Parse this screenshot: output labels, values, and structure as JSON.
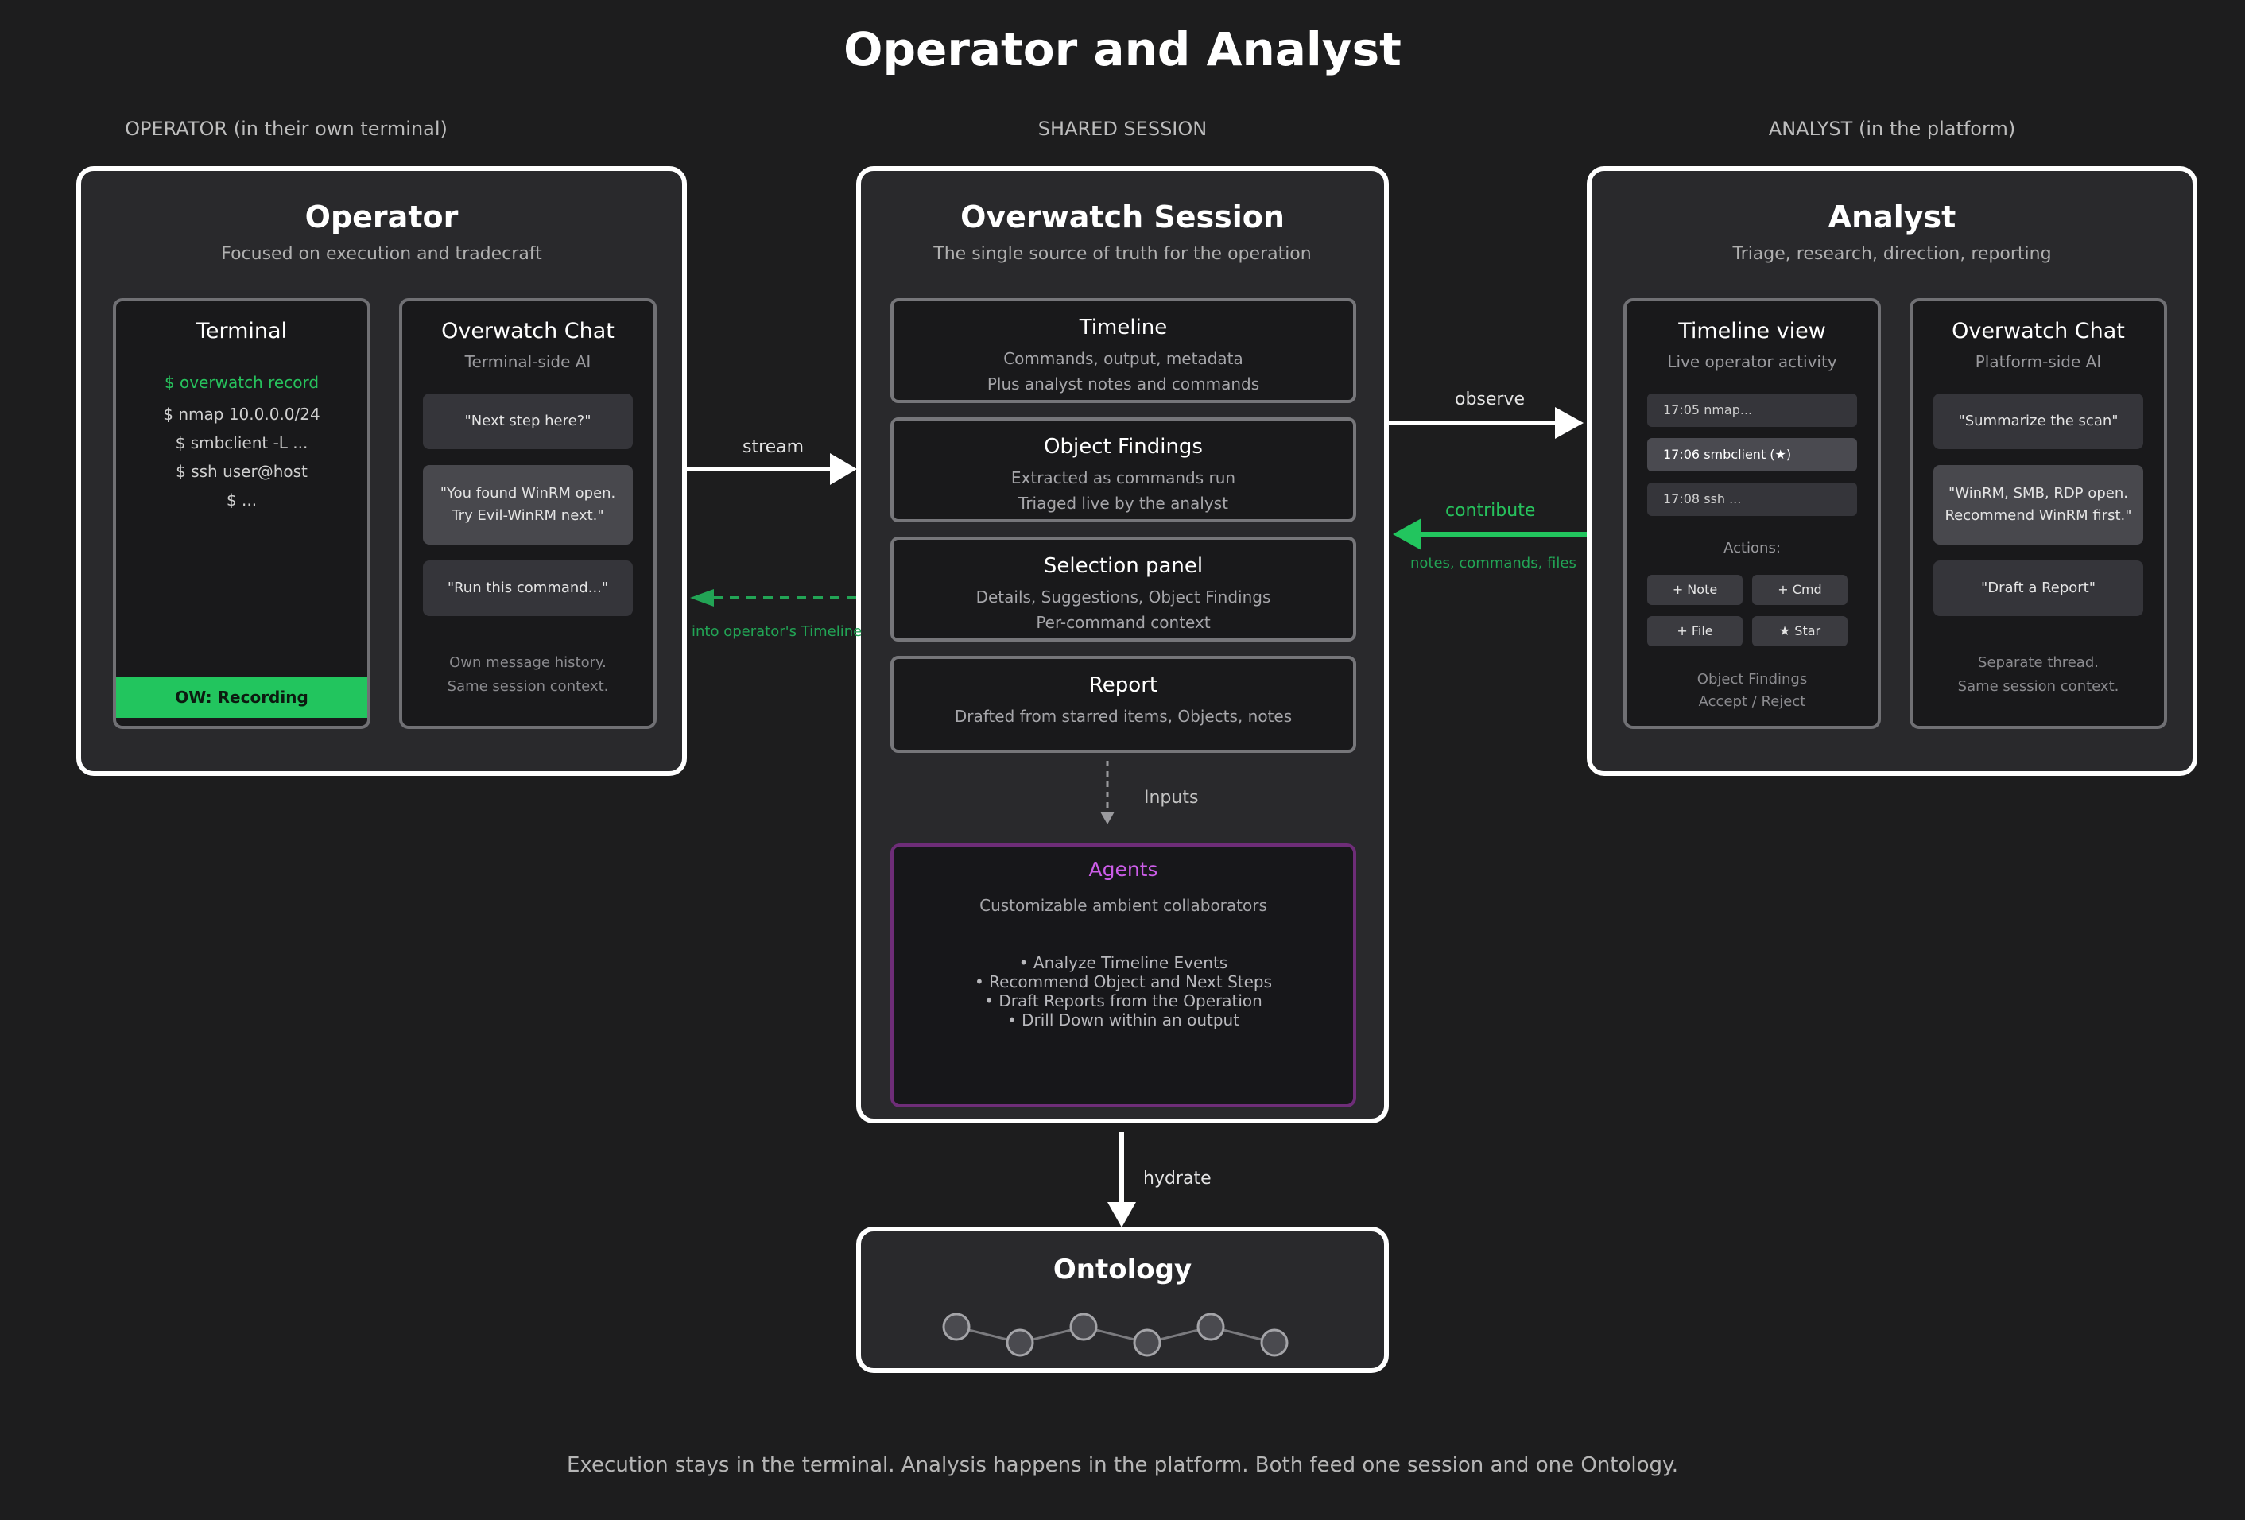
{
  "title": "Operator and Analyst",
  "columns": {
    "operator": "OPERATOR (in their own terminal)",
    "shared": "SHARED SESSION",
    "analyst": "ANALYST (in the platform)"
  },
  "operator": {
    "title": "Operator",
    "subtitle": "Focused on execution and tradecraft",
    "terminal": {
      "title": "Terminal",
      "lines": [
        "$ overwatch record",
        "$ nmap 10.0.0.0/24",
        "$ smbclient -L ...",
        "$ ssh user@host",
        "$ ..."
      ],
      "status": "OW: Recording"
    },
    "chat": {
      "title": "Overwatch Chat",
      "subtitle": "Terminal-side AI",
      "bubbles": [
        "\"Next step here?\"",
        "\"You found WinRM open.",
        "Try Evil-WinRM next.\"",
        "\"Run this command...\""
      ],
      "note1": "Own message history.",
      "note2": "Same session context."
    }
  },
  "session": {
    "title": "Overwatch Session",
    "subtitle": "The single source of truth for the operation",
    "timeline": {
      "title": "Timeline",
      "line1": "Commands, output, metadata",
      "line2": "Plus analyst notes and commands"
    },
    "findings": {
      "title": "Object Findings",
      "line1": "Extracted as commands run",
      "line2": "Triaged live by the analyst"
    },
    "selection": {
      "title": "Selection panel",
      "line1": "Details, Suggestions, Object Findings",
      "line2": "Per-command context"
    },
    "report": {
      "title": "Report",
      "line1": "Drafted from starred items, Objects, notes"
    },
    "inputs_label": "Inputs",
    "agents": {
      "title": "Agents",
      "subtitle": "Customizable ambient collaborators",
      "items": [
        "• Analyze Timeline Events",
        "• Recommend Object and Next Steps",
        "• Draft Reports from the Operation",
        "• Drill Down within an output"
      ]
    }
  },
  "analyst": {
    "title": "Analyst",
    "subtitle": "Triage, research, direction, reporting",
    "timeline_view": {
      "title": "Timeline view",
      "subtitle": "Live operator activity",
      "items": [
        "17:05 nmap...",
        "17:06 smbclient (★)",
        "17:08 ssh ..."
      ],
      "actions_label": "Actions:",
      "actions": [
        "+ Note",
        "+ Cmd",
        "+ File",
        "★ Star"
      ],
      "findings1": "Object Findings",
      "findings2": "Accept / Reject"
    },
    "chat": {
      "title": "Overwatch Chat",
      "subtitle": "Platform-side AI",
      "bubbles": [
        "\"Summarize the scan\"",
        "\"WinRM, SMB, RDP open.",
        "Recommend WinRM first.\"",
        "\"Draft a Report\""
      ],
      "note1": "Separate thread.",
      "note2": "Same session context."
    }
  },
  "arrows": {
    "stream": "stream",
    "into_timeline": "into operator's Timeline",
    "observe": "observe",
    "contribute": "contribute",
    "contribute_sub": "notes, commands, files",
    "hydrate": "hydrate"
  },
  "ontology": {
    "title": "Ontology"
  },
  "footer": "Execution stays in the terminal. Analysis happens in the platform. Both feed one session and one Ontology."
}
